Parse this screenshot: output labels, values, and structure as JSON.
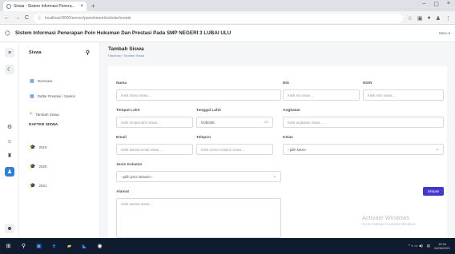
{
  "browser": {
    "tab_title": "Siswa - Sistem Informasi Penera...",
    "tab_close": "×",
    "new_tab": "+",
    "url": "localhost:8000/server/punishment/scholar/create",
    "window_controls": [
      "–",
      "▢",
      "×"
    ]
  },
  "app": {
    "title": "Sistem Informasi Penerapan Poin Hukuman Dan Prestasi Pada SMP NEGERI 3 LUBAI ULU",
    "user_menu": "Meru ▾"
  },
  "sidebar": {
    "title": "Siswa",
    "items": [
      {
        "label": "Overview",
        "icon": "grid-icon"
      },
      {
        "label": "Daftar Prestasi / Sanksi",
        "icon": "grid-icon"
      },
      {
        "label": "Tambah Siswa",
        "icon": "plus-icon"
      }
    ],
    "section_title": "DAFTAR SISWA",
    "years": [
      "2019",
      "2020",
      "2021"
    ]
  },
  "page": {
    "title": "Tambah Siswa",
    "breadcrumb": "Halaman / Tambah Siswa"
  },
  "form": {
    "nama": {
      "label": "Nama",
      "placeholder": "Ketik nama siswa ..."
    },
    "nis": {
      "label": "NIS",
      "placeholder": "Ketik nis siswa ..."
    },
    "nisn": {
      "label": "NISN",
      "placeholder": "Ketik nisn siswa ..."
    },
    "tempat_lahir": {
      "label": "Tempat Lahir",
      "placeholder": "Ketik tempat lahir siswa ..."
    },
    "tanggal_lahir": {
      "label": "Tanggal Lahir",
      "placeholder": "hh/bb/tttt"
    },
    "angkatan": {
      "label": "Angkatan",
      "placeholder": "Ketik angkatan siswa ..."
    },
    "email": {
      "label": "Email",
      "placeholder": "Ketik alamat email siswa ..."
    },
    "telepon": {
      "label": "Telepon",
      "placeholder": "Ketik nomor telepon siswa ..."
    },
    "kelas": {
      "label": "Kelas",
      "value": "--pilih kelas--"
    },
    "jenis_kelamin": {
      "label": "Jenis Kelamin",
      "value": "--pilih jenis kelamin--"
    },
    "alamat": {
      "label": "Alamat",
      "placeholder": "Ketik alamat siswa ..."
    },
    "submit": "Simpan"
  },
  "watermark": {
    "line1": "Activate Windows",
    "line2": "Go to Settings to activate Windows."
  },
  "taskbar": {
    "time": "15:34",
    "date": "24/06/2021"
  },
  "colors": {
    "accent": "#4338ca",
    "link": "#2f7ed8",
    "taskbar": "#0f1b2e"
  }
}
